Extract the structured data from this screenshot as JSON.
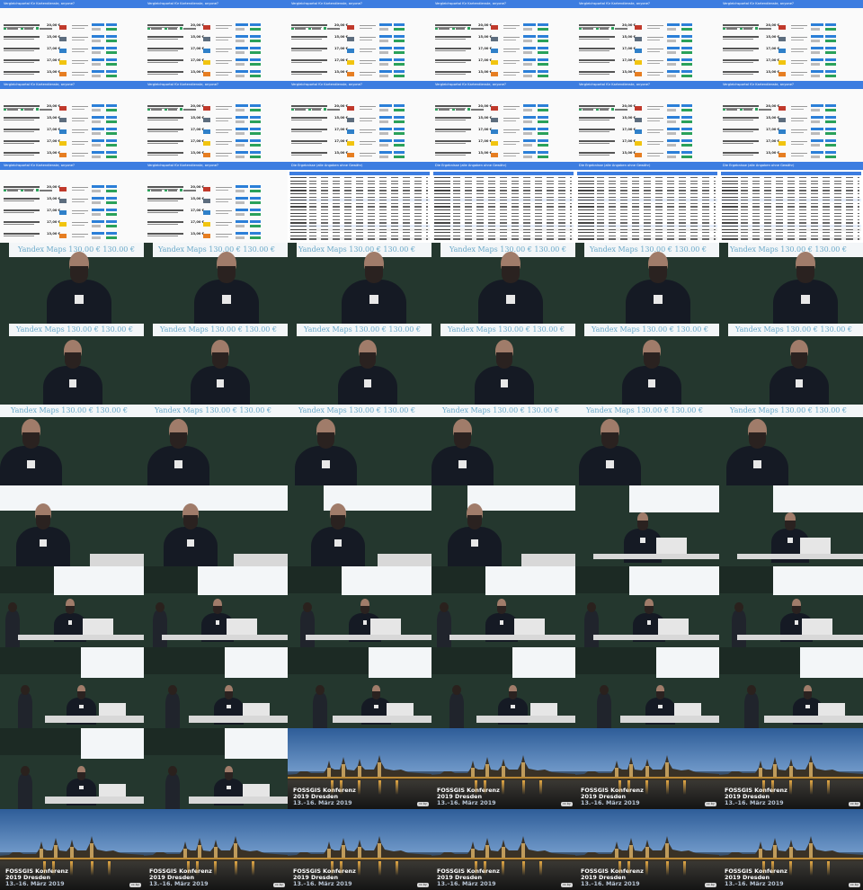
{
  "slide_title": "Vergleichsportal für Kartendienste, anyone?",
  "table_title": "Die Ergebnisse (alle Angaben ohne Gewähr)",
  "screen_logo": "Yandex Maps",
  "screen_price": "130.00 €",
  "caption_line1": "FOSSGIS Konferenz",
  "caption_line2": "2019 Dresden",
  "caption_line3": "13.–16. März 2019",
  "watermark": "cc by",
  "grid": {
    "columns": 6,
    "rows": 11,
    "tiles": [
      "slide",
      "slide",
      "slide",
      "slide",
      "slide",
      "slide",
      "slide",
      "slide",
      "slide",
      "slide",
      "slide",
      "slide",
      "slide",
      "slide",
      "table",
      "table",
      "table",
      "table",
      "photo-a",
      "photo-a",
      "photo-a",
      "photo-a",
      "photo-a",
      "photo-a",
      "photo-b",
      "photo-b",
      "photo-b",
      "photo-b",
      "photo-b",
      "photo-b",
      "photo-c",
      "photo-c",
      "photo-c",
      "photo-c",
      "photo-c",
      "photo-c",
      "photo-d",
      "photo-d",
      "photo-e",
      "photo-e",
      "photo-f",
      "photo-f",
      "photo-g",
      "photo-g",
      "photo-g",
      "photo-g",
      "photo-g",
      "photo-g",
      "photo-h",
      "photo-h",
      "photo-h",
      "photo-h",
      "photo-h",
      "photo-h",
      "photo-h",
      "photo-h",
      "city",
      "city",
      "city",
      "city",
      "city",
      "city",
      "city",
      "city",
      "city",
      "city"
    ]
  },
  "colors": {
    "slide_bar": "#3d7de0",
    "button_blue": "#2b7fd8",
    "button_green": "#2aa15a",
    "board": "#24372e"
  }
}
